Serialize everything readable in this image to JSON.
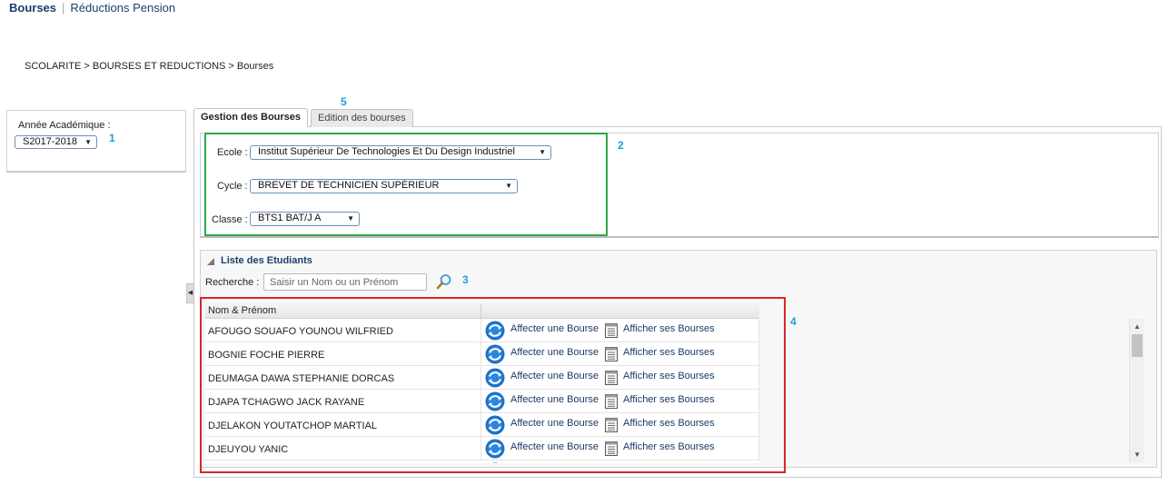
{
  "topnav": {
    "active": "Bourses",
    "link": "Réductions Pension"
  },
  "breadcrumb": "SCOLARITE > BOURSES ET REDUCTIONS > Bourses",
  "left_panel": {
    "label": "Année Académique :",
    "value": "S2017-2018"
  },
  "tabs": [
    {
      "label": "Gestion des Bourses",
      "active": true
    },
    {
      "label": "Edition des bourses",
      "active": false
    }
  ],
  "filters": {
    "ecole_label": "Ecole :",
    "ecole_value": "Institut Supérieur De Technologies Et Du Design Industriel",
    "cycle_label": "Cycle :",
    "cycle_value": "BREVET DE TECHNICIEN SUPÉRIEUR",
    "classe_label": "Classe :",
    "classe_value": "BTS1 BAT/J A"
  },
  "list": {
    "title": "Liste des Etudiants",
    "search_label": "Recherche :",
    "search_placeholder": "Saisir un Nom ou un Prénom",
    "column_name": "Nom & Prénom",
    "action_affect": "Affecter une Bourse",
    "action_show": "Afficher ses Bourses",
    "rows": [
      "AFOUGO SOUAFO YOUNOU WILFRIED",
      "BOGNIE FOCHE PIERRE",
      "DEUMAGA DAWA STEPHANIE DORCAS",
      "DJAPA TCHAGWO JACK RAYANE",
      "DJELAKON YOUTATCHOP MARTIAL",
      "DJEUYOU YANIC"
    ]
  },
  "annotations": [
    "1",
    "2",
    "3",
    "4",
    "5"
  ],
  "colors": {
    "accent": "#1a3f6b",
    "annotation": "#1aa0d8",
    "green_box": "#2fa94a",
    "red_box": "#d9262b",
    "affect_icon": "#1f6fc4"
  },
  "icons": {
    "search": "magnifier-icon",
    "affect": "refresh-circle-icon",
    "show": "document-list-icon"
  }
}
